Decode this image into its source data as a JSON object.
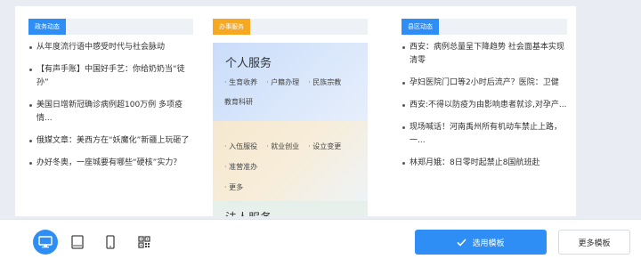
{
  "columns": {
    "left": {
      "tag": "政务动态",
      "items": [
        "从年度流行语中感受时代与社会脉动",
        "【有声手账】中国好手艺：你给奶奶当“徒孙”",
        "美国日增新冠确诊病例超100万例 多项疫情...",
        "俄媒文章：美西方在“妖魔化”新疆上玩砸了",
        "办好冬奥，一座城要有哪些“硬核”实力？"
      ]
    },
    "middle": {
      "tag": "办事服务",
      "personal_title": "个人服务",
      "personal_links": [
        "生育收养",
        "户籍办理",
        "民族宗教",
        "教育科研"
      ],
      "extra_links": [
        "入伍服役",
        "就业创业",
        "设立变更",
        "准营准办",
        "更多"
      ],
      "legal_title": "法人服务"
    },
    "right": {
      "tag": "县区动态",
      "items": [
        "西安：病例总量呈下降趋势 社会面基本实现清零",
        "孕妇医院门口等2小时后流产？医院：卫健",
        "西安:不得以防疫为由影响患者就诊,对孕产...",
        "现场喊话！河南禹州所有机动车禁止上路，一...",
        "林郑月娥：8日零时起禁止8国航班赴"
      ]
    }
  },
  "toolbar": {
    "devices": [
      "desktop-icon",
      "tablet-icon",
      "phone-icon",
      "qr-code-icon"
    ],
    "primary_label": "选用模板",
    "secondary_label": "更多模板"
  },
  "colors": {
    "accent": "#2f8ef6",
    "orange": "#f7a823"
  }
}
